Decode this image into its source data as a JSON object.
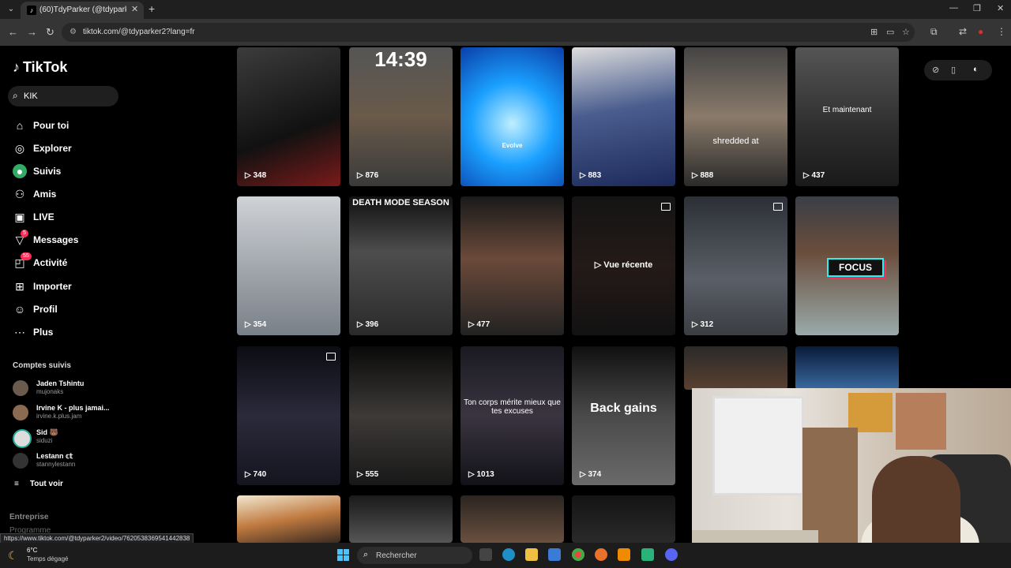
{
  "browser": {
    "tab_title": "(60)TdyParker (@tdyparker2) | T",
    "tab_favicon": "♪",
    "url": "tiktok.com/@tdyparker2?lang=fr",
    "status_url": "https://www.tiktok.com/@tdyparker2/video/7620538369541442838"
  },
  "sidebar": {
    "logo": "TikTok",
    "search_value": "KIK",
    "nav": [
      {
        "label": "Pour toi",
        "icon": "home-icon"
      },
      {
        "label": "Explorer",
        "icon": "compass-icon"
      },
      {
        "label": "Suivis",
        "icon": "following-avatar-icon"
      },
      {
        "label": "Amis",
        "icon": "friends-icon"
      },
      {
        "label": "LIVE",
        "icon": "live-icon"
      },
      {
        "label": "Messages",
        "icon": "messages-icon",
        "badge": "5"
      },
      {
        "label": "Activité",
        "icon": "activity-icon",
        "badge": "55"
      },
      {
        "label": "Importer",
        "icon": "upload-icon"
      },
      {
        "label": "Profil",
        "icon": "profile-icon"
      },
      {
        "label": "Plus",
        "icon": "more-icon"
      }
    ],
    "followed_title": "Comptes suivis",
    "followed": [
      {
        "name": "Jaden Tshintu",
        "handle": "mujonaks"
      },
      {
        "name": "Irvine K - plus jamai...",
        "handle": "irvine.k.plus.jam"
      },
      {
        "name": "Sid 🐻",
        "handle": "siduzi"
      },
      {
        "name": "Lestann 𝕔𝕥",
        "handle": "stannylestann"
      }
    ],
    "see_all": "Tout voir",
    "company": "Entreprise",
    "programs": "Programme"
  },
  "videos": [
    {
      "views": "348",
      "caption": ""
    },
    {
      "views": "876",
      "caption": "14:39"
    },
    {
      "views": "",
      "caption": "Evolve"
    },
    {
      "views": "883",
      "caption": ""
    },
    {
      "views": "888",
      "caption": "shredded at"
    },
    {
      "views": "437",
      "caption": "Et maintenant"
    },
    {
      "views": "354",
      "caption": ""
    },
    {
      "views": "396",
      "caption": "DEATH MODE SEASON"
    },
    {
      "views": "477",
      "caption": ""
    },
    {
      "views": "",
      "caption": "▷ Vue récente"
    },
    {
      "views": "312",
      "caption": ""
    },
    {
      "views": "",
      "caption": "FOCUS"
    },
    {
      "views": "740",
      "caption": ""
    },
    {
      "views": "555",
      "caption": ""
    },
    {
      "views": "1013",
      "caption": "Ton corps mérite mieux que tes excuses"
    },
    {
      "views": "374",
      "caption": "Back gains"
    }
  ],
  "taskbar": {
    "temp": "6°C",
    "weather": "Temps dégagé",
    "search_label": "Rechercher"
  }
}
